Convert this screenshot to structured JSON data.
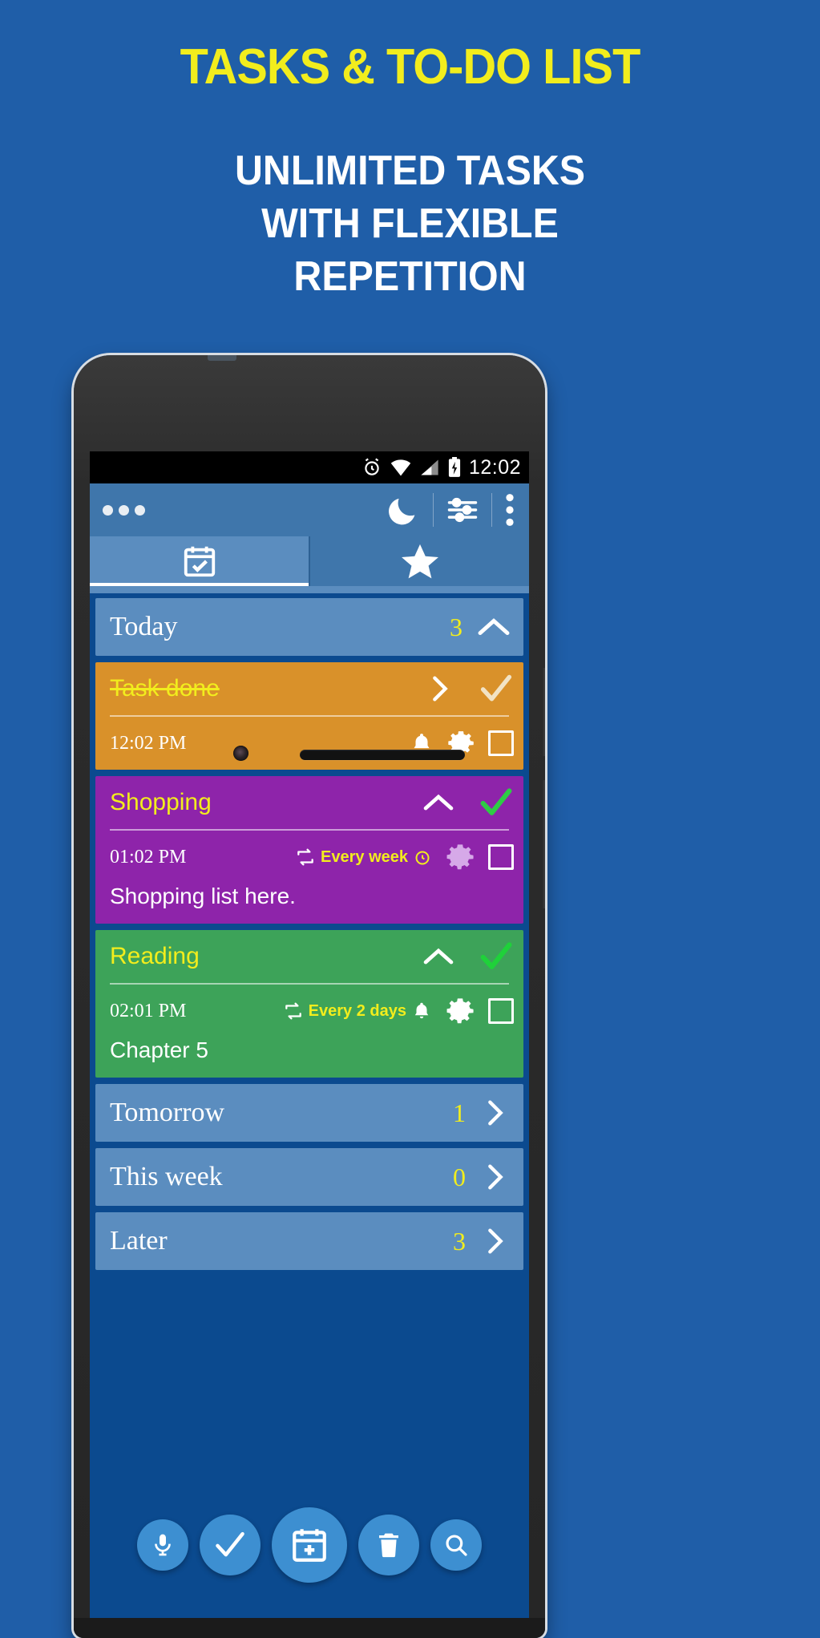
{
  "promo": {
    "title": "TASKS & TO-DO LIST",
    "subtitle_line1": "UNLIMITED TASKS",
    "subtitle_line2": "WITH FLEXIBLE",
    "subtitle_line3": "REPETITION",
    "title_color": "#f2ed1d",
    "subtitle_color": "#ffffff",
    "background_color": "#1f5ea8"
  },
  "statusbar": {
    "clock": "12:02",
    "icons": [
      "alarm-icon",
      "wifi-icon",
      "signal-icon",
      "battery-charging-icon"
    ]
  },
  "toolbar": {
    "drag_handle": "three-dots-icon",
    "night_mode": "moon-icon",
    "filter": "sliders-icon",
    "overflow": "vertical-dots-icon"
  },
  "tabs": [
    {
      "name": "tab-calendar",
      "icon": "calendar-check-icon",
      "active": true
    },
    {
      "name": "tab-starred",
      "icon": "star-icon",
      "active": false
    }
  ],
  "groups": {
    "today": {
      "label": "Today",
      "count": "3",
      "chevron": "chevron-up-icon"
    },
    "tomorrow": {
      "label": "Tomorrow",
      "count": "1",
      "chevron": "chevron-right-icon"
    },
    "this_week": {
      "label": "This week",
      "count": "0",
      "chevron": "chevron-right-icon"
    },
    "later": {
      "label": "Later",
      "count": "3",
      "chevron": "chevron-right-icon"
    }
  },
  "tasks": [
    {
      "title": "Task done",
      "done": true,
      "time": "12:02 PM",
      "repeat": "",
      "note": "",
      "color": "#d9912a",
      "expander": "chevron-right-icon",
      "check": "check-mark-dim-icon",
      "alarm": "bell-icon",
      "settings": "gear-icon",
      "checkbox": "checkbox-unchecked-icon"
    },
    {
      "title": "Shopping",
      "done": false,
      "time": "01:02 PM",
      "repeat": "Every week",
      "note": "Shopping list here.",
      "color": "#8e24aa",
      "expander": "chevron-up-icon",
      "check": "check-mark-green-icon",
      "alarm": "alarm-clock-icon",
      "settings": "gear-icon",
      "checkbox": "checkbox-unchecked-icon"
    },
    {
      "title": "Reading",
      "done": false,
      "time": "02:01 PM",
      "repeat": "Every 2 days",
      "note": "Chapter 5",
      "color": "#3da359",
      "expander": "chevron-up-icon",
      "check": "check-mark-green-icon",
      "alarm": "bell-icon",
      "settings": "gear-icon",
      "checkbox": "checkbox-unchecked-icon"
    }
  ],
  "fabs": [
    {
      "name": "voice-input-fab",
      "icon": "microphone-icon",
      "size": "sm"
    },
    {
      "name": "complete-fab",
      "icon": "check-icon",
      "size": "md"
    },
    {
      "name": "add-task-fab",
      "icon": "calendar-plus-icon",
      "size": "lg"
    },
    {
      "name": "delete-fab",
      "icon": "trash-icon",
      "size": "md"
    },
    {
      "name": "search-fab",
      "icon": "search-icon",
      "size": "sm"
    }
  ]
}
